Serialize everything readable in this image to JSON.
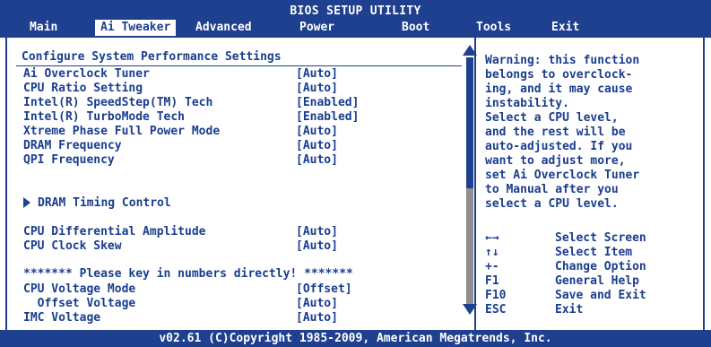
{
  "window": {
    "title": "BIOS SETUP UTILITY"
  },
  "tabs": [
    {
      "label": "Main"
    },
    {
      "label": "Ai Tweaker"
    },
    {
      "label": "Advanced"
    },
    {
      "label": "Power"
    },
    {
      "label": "Boot"
    },
    {
      "label": "Tools"
    },
    {
      "label": "Exit"
    }
  ],
  "active_tab": "Ai Tweaker",
  "section_title": "Configure System Performance Settings",
  "settings": [
    {
      "label": "Ai Overclock Tuner",
      "value": "[Auto]"
    },
    {
      "label": "CPU Ratio Setting",
      "value": "[Auto]"
    },
    {
      "label": "Intel(R) SpeedStep(TM) Tech",
      "value": "[Enabled]"
    },
    {
      "label": "Intel(R) TurboMode Tech",
      "value": "[Enabled]"
    },
    {
      "label": "Xtreme Phase Full Power Mode",
      "value": "[Auto]"
    },
    {
      "label": "DRAM Frequency",
      "value": "[Auto]"
    },
    {
      "label": "QPI Frequency",
      "value": "[Auto]"
    }
  ],
  "submenu": {
    "label": "DRAM Timing Control"
  },
  "settings2": [
    {
      "label": "CPU Differential Amplitude",
      "value": "[Auto]"
    },
    {
      "label": "CPU Clock Skew",
      "value": "[Auto]"
    }
  ],
  "notice": "******* Please key in numbers directly! *******",
  "settings3": [
    {
      "label": "CPU Voltage Mode",
      "value": "[Offset]"
    },
    {
      "label": "  Offset Voltage",
      "value": "[Auto]"
    },
    {
      "label": "IMC Voltage",
      "value": "[Auto]"
    }
  ],
  "help": {
    "lines": [
      "Warning: this function",
      "belongs to overclock-",
      "ing, and it may cause",
      "instability.",
      "Select a CPU level,",
      "and the rest will be",
      "auto-adjusted. If you",
      "want to adjust more,",
      "set Ai Overclock Tuner",
      "to Manual after you",
      "select a CPU level."
    ]
  },
  "keys": [
    {
      "key": "←→",
      "desc": "Select Screen"
    },
    {
      "key": "↑↓",
      "desc": "Select Item"
    },
    {
      "key": "+-",
      "desc": "Change Option"
    },
    {
      "key": "F1",
      "desc": "General Help"
    },
    {
      "key": "F10",
      "desc": "Save and Exit"
    },
    {
      "key": "ESC",
      "desc": "Exit"
    }
  ],
  "footer": "v02.61 (C)Copyright 1985-2009, American Megatrends, Inc.",
  "colors": {
    "primary": "#1f3f8f",
    "background": "#ffffff",
    "scroll_track": "#8f8f8f"
  }
}
